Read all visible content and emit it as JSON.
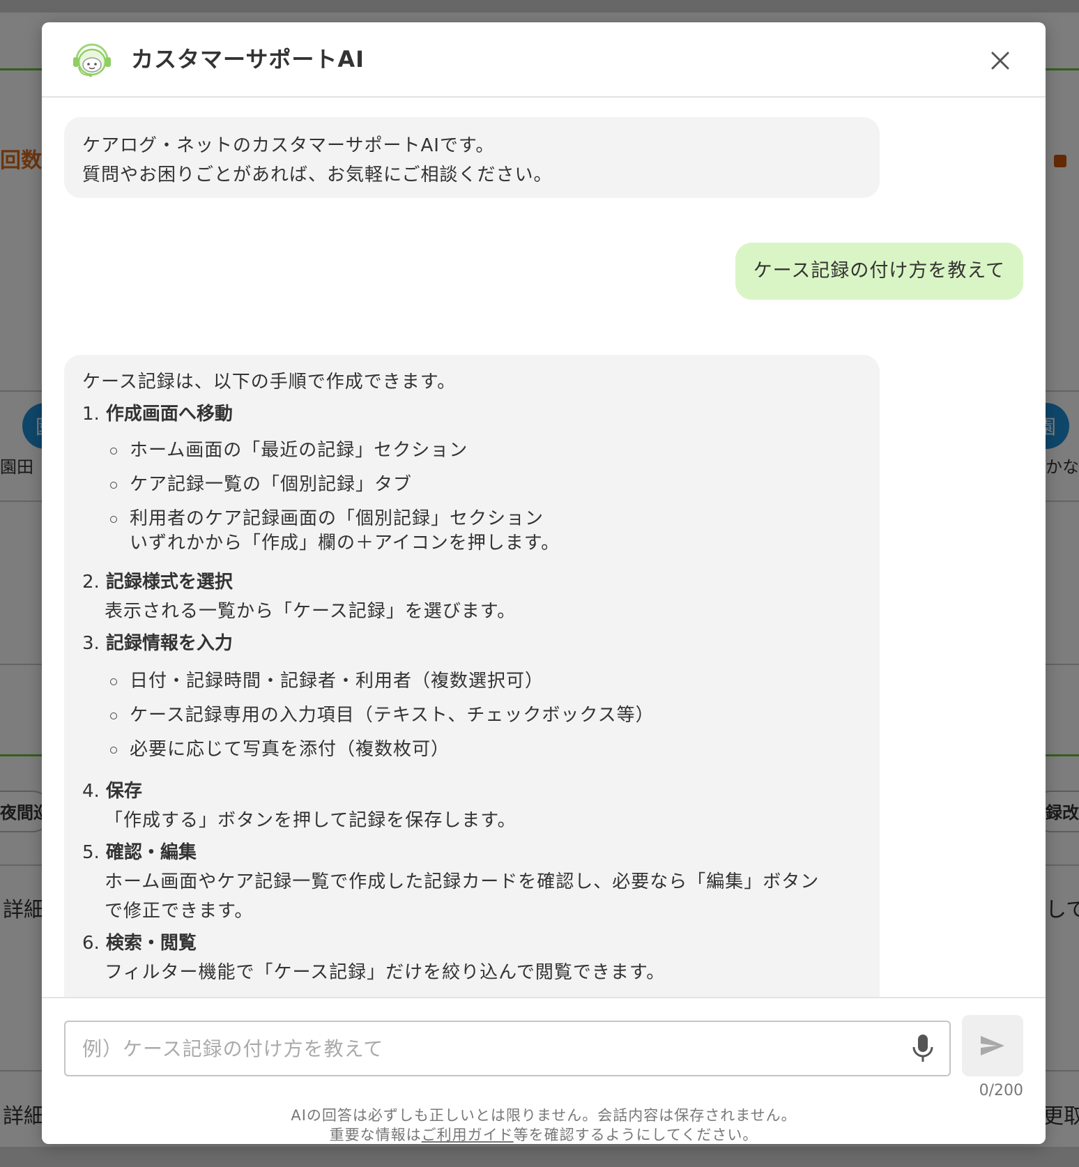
{
  "background": {
    "left_texts": [
      "回数",
      "園田 ",
      "夜間巡",
      "詳細",
      "詳細"
    ],
    "right_texts": [
      "かな",
      "録改",
      "して",
      "更取"
    ],
    "avatar_char": "園"
  },
  "modal": {
    "title": "カスタマーサポートAI",
    "close_icon": "close-icon",
    "logo_icon": "support-robot-icon"
  },
  "chat": {
    "intro": {
      "line1": "ケアログ・ネットのカスタマーサポートAIです。",
      "line2": "質問やお困りごとがあれば、お気軽にご相談ください。"
    },
    "user_message": "ケース記録の付け方を教えて",
    "answer": {
      "intro": "ケース記録は、以下の手順で作成できます。",
      "steps": [
        {
          "num": "1.",
          "title": "作成画面へ移動",
          "bullets": [
            "ホーム画面の「最近の記録」セクション",
            "ケア記録一覧の「個別記録」タブ",
            "利用者のケア記録画面の「個別記録」セクション"
          ],
          "bullet_cont": "いずれかから「作成」欄の＋アイコンを押します。"
        },
        {
          "num": "2.",
          "title": "記録様式を選択",
          "desc": "表示される一覧から「ケース記録」を選びます。"
        },
        {
          "num": "3.",
          "title": "記録情報を入力",
          "bullets": [
            "日付・記録時間・記録者・利用者（複数選択可）",
            "ケース記録専用の入力項目（テキスト、チェックボックス等）",
            "必要に応じて写真を添付（複数枚可）"
          ]
        },
        {
          "num": "4.",
          "title": "保存",
          "desc": "「作成する」ボタンを押して記録を保存します。"
        },
        {
          "num": "5.",
          "title": "確認・編集",
          "desc": "ホーム画面やケア記録一覧で作成した記録カードを確認し、必要なら「編集」ボタン",
          "desc2": "で修正できます。"
        },
        {
          "num": "6.",
          "title": "検索・閲覧",
          "desc": "フィルター機能で「ケース記録」だけを絞り込んで閲覧できます。"
        }
      ]
    }
  },
  "input": {
    "placeholder": "例）ケース記録の付け方を教えて",
    "value": "",
    "counter": "0/200",
    "mic_icon": "microphone-icon",
    "send_icon": "send-icon"
  },
  "disclaimer": {
    "line1": "AIの回答は必ずしも正しいとは限りません。会話内容は保存されません。",
    "line2_prefix": "重要な情報は",
    "link": "ご利用ガイド",
    "line2_suffix": "等を確認するようにしてください。"
  },
  "colors": {
    "user_bubble": "#daf5c5",
    "ai_bubble": "#f3f3f3",
    "accent_green": "#6cbb3c",
    "background_orange": "#d46a1d"
  }
}
